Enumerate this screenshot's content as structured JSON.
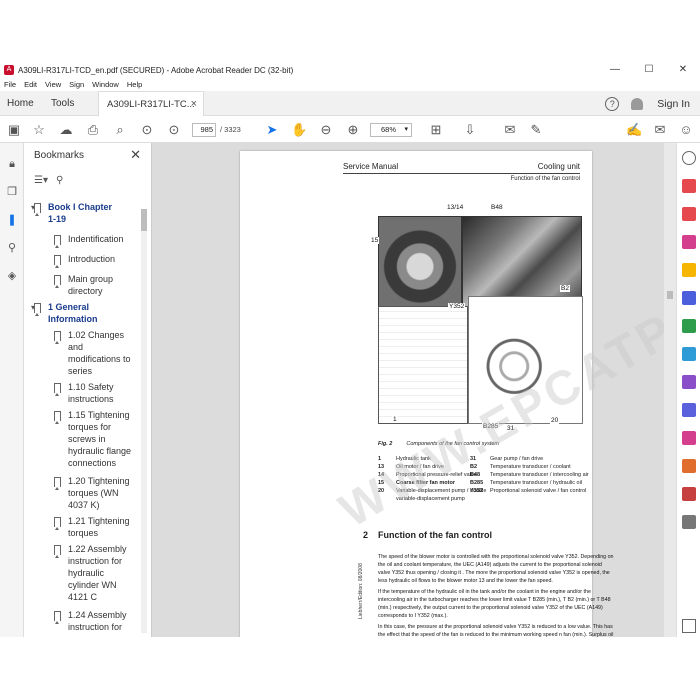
{
  "window": {
    "title": "A309LI-R317LI-TCD_en.pdf (SECURED) - Adobe Acrobat Reader DC (32-bit)",
    "minimize": "—",
    "maximize": "☐",
    "close": "✕"
  },
  "menu": [
    "File",
    "Edit",
    "View",
    "Sign",
    "Window",
    "Help"
  ],
  "tabs": {
    "home": "Home",
    "tools": "Tools",
    "doc": "A309LI-R317LI-TC...",
    "help": "?",
    "signin": "Sign In"
  },
  "toolbar": {
    "page_current": "985",
    "page_total": "/ 3323",
    "zoom": "68%"
  },
  "bookmarks": {
    "title": "Bookmarks",
    "items": [
      {
        "label": "Book I Chapter 1-19",
        "lines": [
          "Book I Chapter",
          "1-19"
        ]
      },
      {
        "label": "Indentification",
        "lines": [
          "Indentification"
        ]
      },
      {
        "label": "Introduction",
        "lines": [
          "Introduction"
        ]
      },
      {
        "label": "Main group directory",
        "lines": [
          "Main group",
          "directory"
        ]
      },
      {
        "label": "1 General Information",
        "lines": [
          "1 General",
          "Information"
        ]
      },
      {
        "label": "1.02 Changes and modifications to series",
        "lines": [
          "1.02 Changes",
          "and",
          "modifications to",
          "series"
        ]
      },
      {
        "label": "1.10 Safety instructions",
        "lines": [
          "1.10 Safety",
          "instructions"
        ]
      },
      {
        "label": "1.15 Tightening torques for screws in hydraulic flange connections",
        "lines": [
          "1.15 Tightening",
          "torques for",
          "screws in",
          "hydraulic flange",
          "connections"
        ]
      },
      {
        "label": "1.20 Tightening torques (WN 4037 K)",
        "lines": [
          "1.20 Tightening",
          "torques (WN",
          "4037 K)"
        ]
      },
      {
        "label": "1.21 Tightening torques",
        "lines": [
          "1.21 Tightening",
          "torques"
        ]
      },
      {
        "label": "1.22 Assembly instruction for hydraulic cylinder WN 4121 C",
        "lines": [
          "1.22 Assembly",
          "instruction for",
          "hydraulic",
          "cylinder WN",
          "4121 C"
        ]
      },
      {
        "label": "1.24 Assembly instruction for",
        "lines": [
          "1.24 Assembly",
          "instruction for"
        ]
      }
    ]
  },
  "page": {
    "header_left": "Service Manual",
    "header_right": "Cooling unit",
    "subheader": "Function of the fan control",
    "callouts": {
      "c1314": "13/14",
      "b48": "B48",
      "c15": "15",
      "y352": "Y352",
      "b2": "B2",
      "c1": "1",
      "b285": "B285",
      "c31": "31",
      "c20": "20"
    },
    "fig_label": "Fig. 2",
    "fig_caption": "Components of the fan control system",
    "legend_left": [
      {
        "n": "1",
        "t": "Hydraulic tank"
      },
      {
        "n": "13",
        "t": "Oil motor / fan drive"
      },
      {
        "n": "14",
        "t": "Proportional pressure-relief valve"
      },
      {
        "n": "15",
        "t": "Coarse filter fan motor"
      },
      {
        "n": "20",
        "t": "Variable-displacement pump / double"
      },
      {
        "n": "",
        "t": "variable-displacement pump"
      }
    ],
    "legend_right": [
      {
        "n": "31",
        "t": "Gear pump / fan drive"
      },
      {
        "n": "B2",
        "t": "Temperature transducer / coolant"
      },
      {
        "n": "B48",
        "t": "Temperature transducer / intercooling air"
      },
      {
        "n": "B285",
        "t": "Temperature transducer / hydraulic oil"
      },
      {
        "n": "Y352",
        "t": "Proportional solenoid valve / fan control"
      }
    ],
    "section_num": "2",
    "section_title": "Function of the fan control",
    "paragraphs": [
      [
        "The speed of the blower motor is controlled with the proportional solenoid valve Y352. Depending on",
        "the oil and coolant temperature, the UEC (A149) adjusts the current to the proportional solenoid",
        "valve Y352 thus opening / closing it . The more the proportional solenoid valve Y352 is opened, the",
        "less hydraulic oil flows to the blower motor 13 and the lower the fan speed."
      ],
      [
        "If the temperature of the hydraulic oil in the tank and/or the coolant in the engine and/or the",
        "intercooling air in the turbocharger reaches the lower limit value T B285 (min.), T B2 (min.) or T B48",
        "(min.) respectively, the output current to the proportional solenoid valve Y352 of the UEC (A149)",
        "corresponds to I Y352 (max.)."
      ],
      [
        "In this case, the pressure at the proportional solenoid valve Y352 is reduced to a low value. This has",
        "the effect that the speed of the fan is reduced to the minimum working speed n fan (min.). Surplus oil"
      ]
    ],
    "side_note": "Liebherr/Edition: 08/2008",
    "watermark": "WWW.EPCATPDF.COM"
  }
}
